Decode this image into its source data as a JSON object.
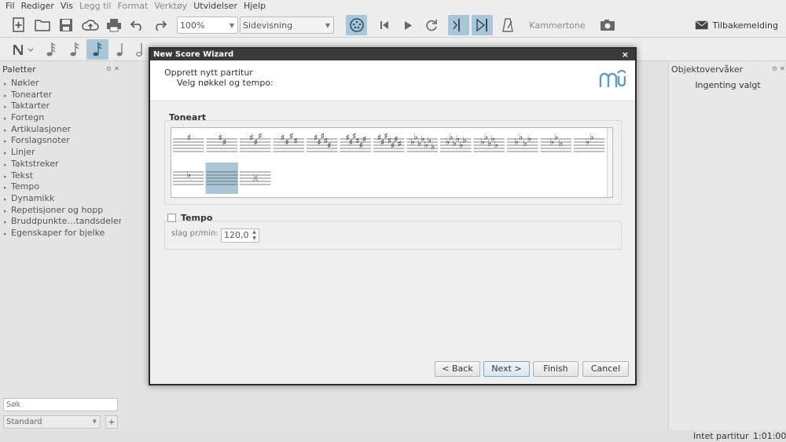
{
  "menubar": {
    "items": [
      {
        "label": "Fil",
        "dim": false
      },
      {
        "label": "Rediger",
        "dim": false
      },
      {
        "label": "Vis",
        "dim": false
      },
      {
        "label": "Legg til",
        "dim": true
      },
      {
        "label": "Format",
        "dim": true
      },
      {
        "label": "Verktøy",
        "dim": true
      },
      {
        "label": "Utvidelser",
        "dim": false
      },
      {
        "label": "Hjelp",
        "dim": false
      }
    ]
  },
  "toolbar": {
    "zoom_value": "100%",
    "view_mode": "Sidevisning",
    "kammertone_label": "Kammertone",
    "feedback_label": "Tilbakemelding"
  },
  "palettes": {
    "title": "Paletter",
    "items": [
      "Nøkler",
      "Tonearter",
      "Taktarter",
      "Fortegn",
      "Artikulasjoner",
      "Forslagsnoter",
      "Linjer",
      "Taktstreker",
      "Tekst",
      "Tempo",
      "Dynamikk",
      "Repetisjoner og hopp",
      "Bruddpunkte…tandsdelere",
      "Egenskaper for bjelke"
    ],
    "search_placeholder": "Søk",
    "workspace": "Standard",
    "add_label": "+"
  },
  "inspector": {
    "title": "Objektovervåker",
    "empty_text": "Ingenting valgt"
  },
  "status": {
    "text": "Intet partitur",
    "time": "1:01:000"
  },
  "dialog": {
    "title": "New Score Wizard",
    "close_glyph": "×",
    "heading": "Opprett nytt partitur",
    "subheading": "Velg nøkkel og tempo:",
    "key_section_label": "Toneart",
    "tempo_label": "Tempo",
    "bpm_label": "slag pr/min:",
    "bpm_value": "120,0",
    "buttons": {
      "back": "< Back",
      "next": "Next >",
      "finish": "Finish",
      "cancel": "Cancel"
    },
    "key_signatures": [
      {
        "accidental": "sharp",
        "count": 1,
        "selected": false
      },
      {
        "accidental": "sharp",
        "count": 2,
        "selected": false
      },
      {
        "accidental": "sharp",
        "count": 3,
        "selected": false
      },
      {
        "accidental": "sharp",
        "count": 4,
        "selected": false
      },
      {
        "accidental": "sharp",
        "count": 5,
        "selected": false
      },
      {
        "accidental": "sharp",
        "count": 6,
        "selected": false
      },
      {
        "accidental": "sharp",
        "count": 7,
        "selected": false
      },
      {
        "accidental": "flat",
        "count": 7,
        "selected": false
      },
      {
        "accidental": "flat",
        "count": 6,
        "selected": false
      },
      {
        "accidental": "flat",
        "count": 5,
        "selected": false
      },
      {
        "accidental": "flat",
        "count": 4,
        "selected": false
      },
      {
        "accidental": "flat",
        "count": 3,
        "selected": false
      },
      {
        "accidental": "flat",
        "count": 2,
        "selected": false
      },
      {
        "accidental": "flat",
        "count": 1,
        "selected": false
      },
      {
        "accidental": "none",
        "count": 0,
        "selected": true
      },
      {
        "accidental": "atonal",
        "count": 0,
        "selected": false
      }
    ]
  },
  "colors": {
    "accent": "#5b9bc4",
    "selection": "#a9c6d8",
    "titlebar": "#3a3a3a"
  }
}
